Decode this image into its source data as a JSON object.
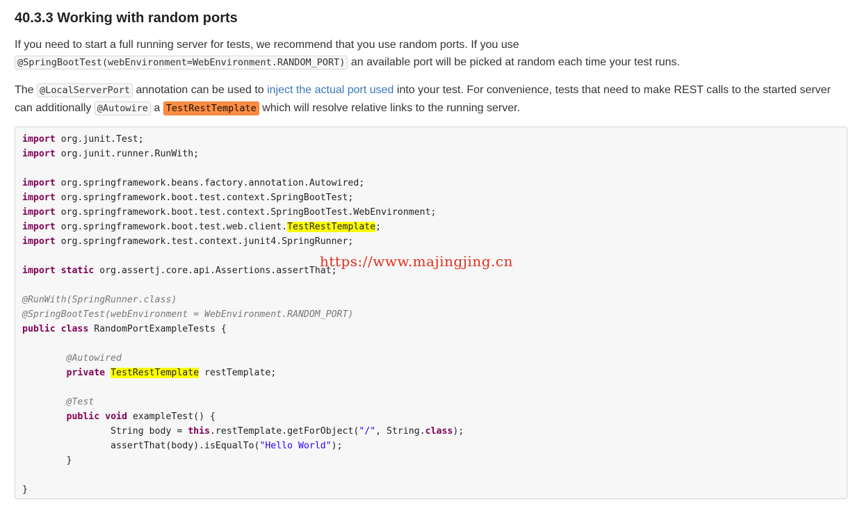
{
  "section": {
    "heading": "40.3.3 Working with random ports"
  },
  "paragraph1": {
    "text_before": "If you need to start a full running server for tests, we recommend that you use random ports. If you use",
    "code": "@SpringBootTest(webEnvironment=WebEnvironment.RANDOM_PORT)",
    "text_after": " an available port will be picked at random each time your test runs."
  },
  "paragraph2": {
    "text_1": "The ",
    "code_1": "@LocalServerPort",
    "text_2": " annotation can be used to ",
    "link": "inject the actual port used",
    "text_3": " into your test. For convenience, tests that need to make REST calls to the started server can additionally ",
    "code_2": "@Autowire",
    "text_4": " a ",
    "code_3": "TestRestTemplate",
    "text_5": " which will resolve relative links to the running server."
  },
  "code": {
    "kw_import": "import",
    "kw_static": "static",
    "kw_public": "public",
    "kw_class": "class",
    "kw_private": "private",
    "kw_void": "void",
    "kw_this": "this",
    "import_1": " org.junit.Test;",
    "import_2": " org.junit.runner.RunWith;",
    "import_3": " org.springframework.beans.factory.annotation.Autowired;",
    "import_4": " org.springframework.boot.test.context.SpringBootTest;",
    "import_5": " org.springframework.boot.test.context.SpringBootTest.WebEnvironment;",
    "import_6_pre": " org.springframework.boot.test.web.client.",
    "import_6_hl": "TestRestTemplate",
    "import_6_post": ";",
    "import_7": " org.springframework.test.context.junit4.SpringRunner;",
    "import_static": " org.assertj.core.api.Assertions.assertThat;",
    "annotation_runwith": "@RunWith(SpringRunner.class)",
    "annotation_springboottest": "@SpringBootTest(webEnvironment = WebEnvironment.RANDOM_PORT)",
    "class_decl": " RandomPortExampleTests {",
    "annotation_autowired": "@Autowired",
    "field_type": "TestRestTemplate",
    "field_name": " restTemplate;",
    "annotation_test": "@Test",
    "method_decl": " exampleTest() {",
    "body_pre": "String body = ",
    "body_mid": ".restTemplate.getForObject(",
    "body_str": "\"/\"",
    "body_mid2": ", String.",
    "body_post": ");",
    "assert_pre": "assertThat(body).isEqualTo(",
    "assert_str": "\"Hello World\"",
    "assert_post": ");",
    "method_close": "}",
    "class_close": "}"
  },
  "watermark": {
    "text": "https://www.majingjing.cn"
  }
}
